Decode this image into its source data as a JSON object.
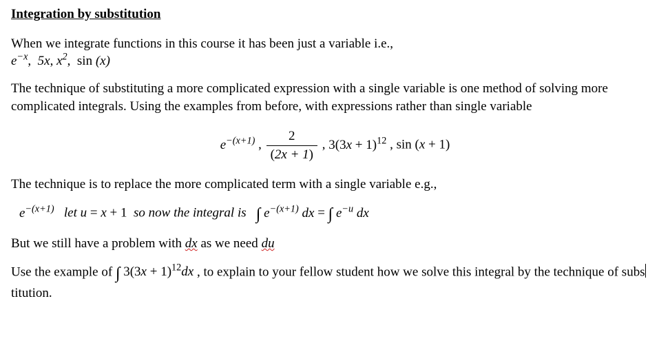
{
  "title": "Integration by substitution",
  "para1_line1": "When we integrate functions in this course it has been just a variable i.e.,",
  "para1_math": "e⁻ˣ,  5x, x²,  sin (x)",
  "para2": "The technique of substituting a more complicated expression with a single variable is one method of solving more complicated integrals. Using the examples from before, with expressions rather than single variable",
  "display": {
    "t1a": "e",
    "t1b": "−(x+1)",
    "sep1": ",   ",
    "frac_num": "2",
    "frac_den": "(2x + 1)",
    "sep2": " ,  ",
    "t3a": "3(3x + 1)",
    "t3b": "12",
    "sep3": ",  ",
    "t4": "sin (x + 1)"
  },
  "para3": "The technique is to replace the more complicated term with a single variable e.g.,",
  "mid": {
    "lhs_base": "e",
    "lhs_exp": "−(x+1)",
    "let": "  let u = x + 1  so now the integral is  ",
    "int1_base": "e",
    "int1_exp": "−(x+1)",
    "dx": " dx",
    "eq": " = ",
    "int2_base": "e",
    "int2_exp": "−u",
    "dx2": " dx"
  },
  "para4_a": "But we still have a problem with ",
  "para4_dx": "dx",
  "para4_b": " as we need ",
  "para4_du": "du",
  "para5_a": "Use the example of     ",
  "para5_int_a": "3(3x + 1)",
  "para5_int_b": "12",
  "para5_int_c": "dx",
  "para5_b": " , to explain to your fellow student how we solve this integral by the technique of subs",
  "para5_c": "titution."
}
